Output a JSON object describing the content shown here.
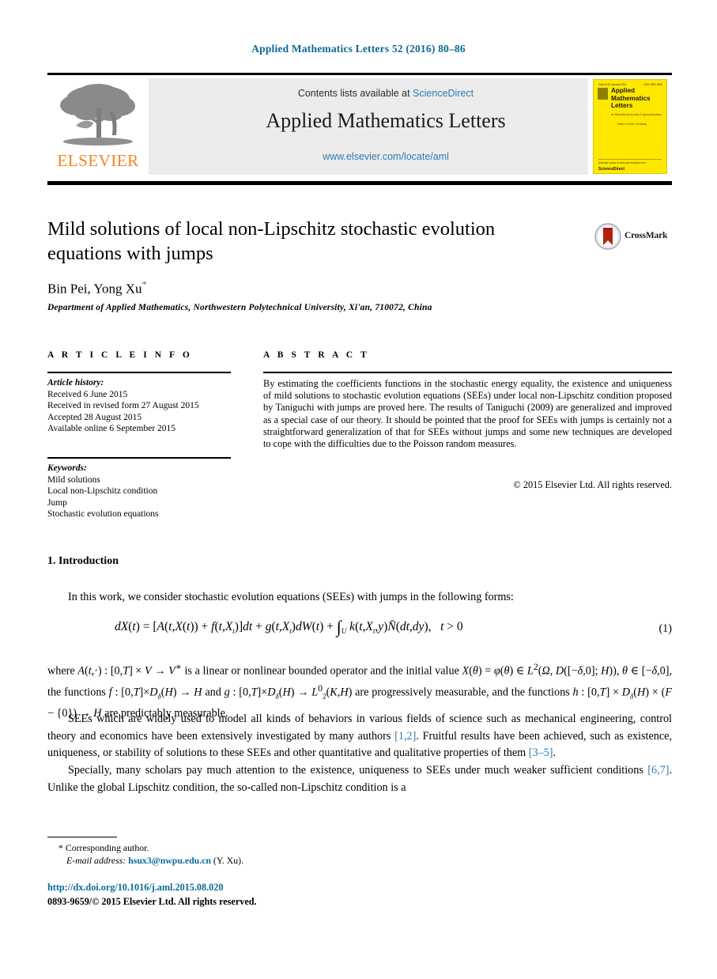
{
  "running_head": "Applied Mathematics Letters 52 (2016) 80–86",
  "masthead": {
    "publisher_name": "ELSEVIER",
    "contents_prefix": "Contents lists available at ",
    "contents_link": "ScienceDirect",
    "journal_title": "Applied Mathematics Letters",
    "journal_url": "www.elsevier.com/locate/aml",
    "cover": {
      "top_left": "Volume 52  January 2016",
      "top_right": "ISSN 0893-9659",
      "title_line1": "Applied",
      "title_line2": "Mathematics",
      "title_line3": "Letters",
      "subtitle": "an international journal of rapid publication",
      "editor": "Editor-in-Chief:  Lan Wang",
      "footer_small": "Available online at www.sciencedirect.com",
      "footer_brand": "ScienceDirect"
    }
  },
  "article": {
    "title": "Mild solutions of local non-Lipschitz stochastic evolution equations with jumps",
    "crossmark_label": "CrossMark",
    "authors": "Bin Pei, Yong Xu",
    "author_star": "*",
    "affiliation": "Department of Applied Mathematics, Northwestern Polytechnical University, Xi'an, 710072, China"
  },
  "article_info": {
    "heading": "A R T I C L E   I N F O",
    "history_label": "Article history:",
    "history": [
      "Received 6 June 2015",
      "Received in revised form 27 August 2015",
      "Accepted 28 August 2015",
      "Available online 6 September 2015"
    ],
    "keywords_label": "Keywords:",
    "keywords": [
      "Mild solutions",
      "Local non-Lipschitz condition",
      "Jump",
      "Stochastic evolution equations"
    ]
  },
  "abstract": {
    "heading": "A B S T R A C T",
    "text": "By estimating the coefficients functions in the stochastic energy equality, the existence and uniqueness of mild solutions to stochastic evolution equations (SEEs) under local non-Lipschitz condition proposed by Taniguchi with jumps are proved here. The results of Taniguchi (2009) are generalized and improved as a special case of our theory. It should be pointed that the proof for SEEs with jumps is certainly not a straightforward generalization of that for SEEs without jumps and some new techniques are developed to cope with the difficulties due to the Poisson random measures.",
    "copyright": "© 2015 Elsevier Ltd. All rights reserved."
  },
  "body": {
    "section_heading": "1.  Introduction",
    "paragraph_1": "In this work, we consider stochastic evolution equations (SEEs) with jumps in the following forms:",
    "equation_number": "(1)",
    "paragraph_3_pre": "SEEs which are widely used to model all kinds of behaviors in various fields of science such as mechanical engineering, control theory and economics have been extensively investigated by many authors ",
    "paragraph_3_cite": "[1,2]",
    "paragraph_3_post": ". Fruitful results have been achieved, such as existence, uniqueness, or stability of solutions to these SEEs and other quantitative and qualitative properties of them ",
    "paragraph_3_cite2": "[3–5]",
    "paragraph_3_end": ".",
    "paragraph_4_pre": "Specially, many scholars pay much attention to the existence, uniqueness to SEEs under much weaker sufficient conditions ",
    "paragraph_4_cite": "[6,7]",
    "paragraph_4_post": ". Unlike the global Lipschitz condition, the so-called non-Lipschitz condition is a"
  },
  "footnotes": {
    "corresponding_marker": "*",
    "corresponding_text": "Corresponding author.",
    "email_label": "E-mail address:",
    "email": "hsux3@nwpu.edu.cn",
    "email_suffix": "(Y. Xu).",
    "doi": "http://dx.doi.org/10.1016/j.aml.2015.08.020",
    "issn_line": "0893-9659/© 2015 Elsevier Ltd. All rights reserved."
  }
}
